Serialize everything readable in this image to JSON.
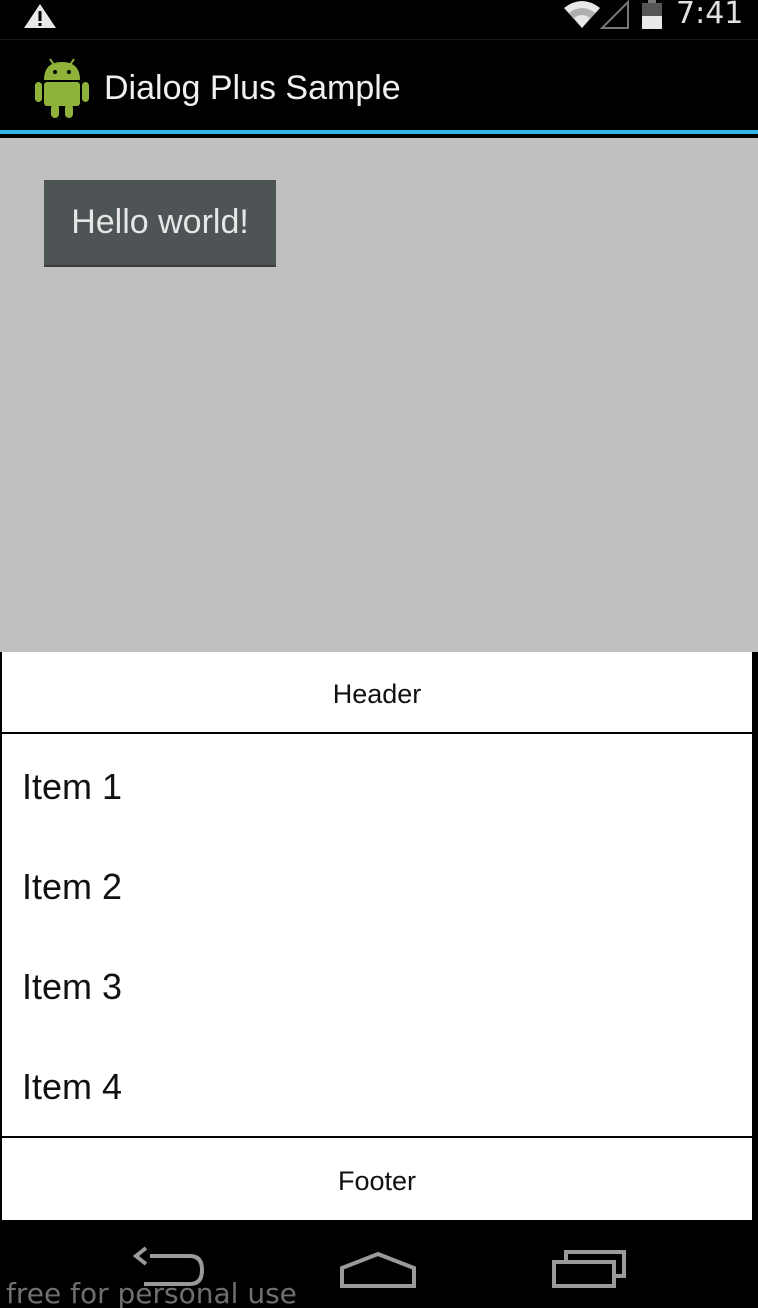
{
  "status_bar": {
    "time": "7:41",
    "icons": [
      "warning-icon",
      "wifi-icon",
      "signal-icon",
      "battery-icon"
    ]
  },
  "action_bar": {
    "title": "Dialog Plus Sample",
    "icon": "android-icon",
    "accent_color": "#33b5e5"
  },
  "content": {
    "button_label": "Hello world!",
    "background_color": "#c0c0c0"
  },
  "dialog": {
    "header": "Header",
    "items": [
      "Item 1",
      "Item 2",
      "Item 3",
      "Item 4"
    ],
    "footer": "Footer"
  },
  "nav_bar": {
    "buttons": [
      "back-icon",
      "home-icon",
      "recent-apps-icon"
    ]
  },
  "watermark": "free for personal use"
}
